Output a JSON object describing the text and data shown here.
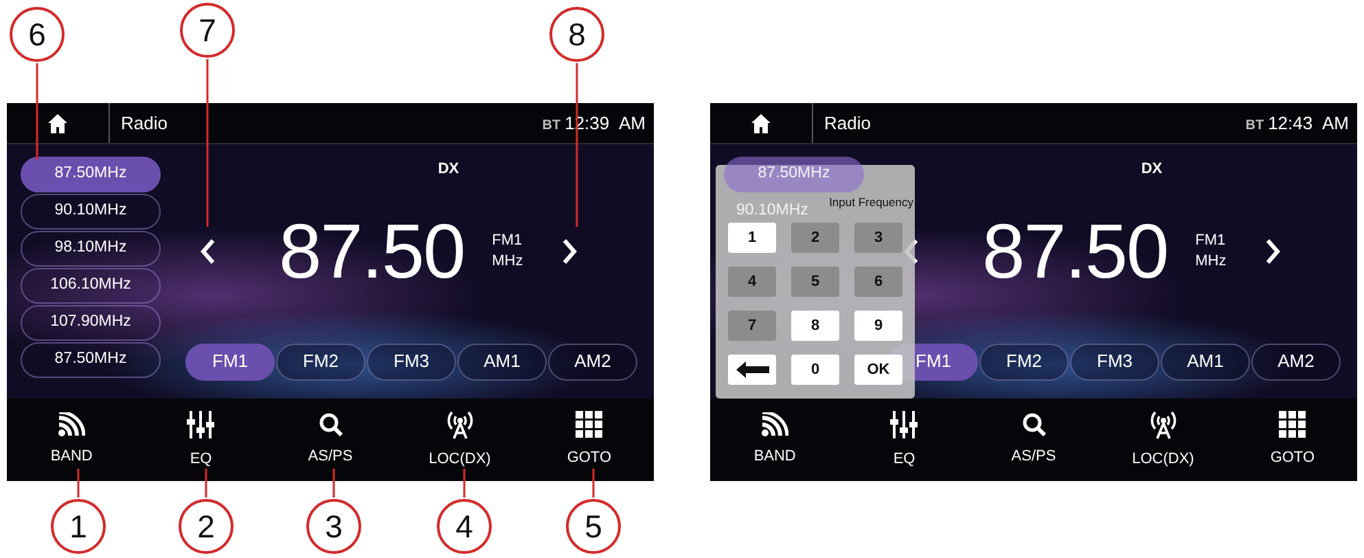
{
  "callouts": [
    {
      "number": "6"
    },
    {
      "number": "7"
    },
    {
      "number": "8"
    },
    {
      "number": "1"
    },
    {
      "number": "2"
    },
    {
      "number": "3"
    },
    {
      "number": "4"
    },
    {
      "number": "5"
    }
  ],
  "screens": [
    {
      "title": "Radio",
      "bt": "BT",
      "time": "12:39 AM",
      "presets": [
        {
          "label": "87.50MHz",
          "selected": true
        },
        {
          "label": "90.10MHz",
          "selected": false
        },
        {
          "label": "98.10MHz",
          "selected": false
        },
        {
          "label": "106.10MHz",
          "selected": false
        },
        {
          "label": "107.90MHz",
          "selected": false
        },
        {
          "label": "87.50MHz",
          "selected": false
        }
      ],
      "mode": "DX",
      "frequency": "87.50",
      "band": "FM1",
      "unit": "MHz",
      "bands": [
        {
          "label": "FM1",
          "selected": true
        },
        {
          "label": "FM2",
          "selected": false
        },
        {
          "label": "FM3",
          "selected": false
        },
        {
          "label": "AM1",
          "selected": false
        },
        {
          "label": "AM2",
          "selected": false
        }
      ],
      "buttons": [
        {
          "label": "BAND",
          "kind": "band"
        },
        {
          "label": "EQ",
          "kind": "eq"
        },
        {
          "label": "AS/PS",
          "kind": "search"
        },
        {
          "label": "LOC(DX)",
          "kind": "antenna"
        },
        {
          "label": "GOTO",
          "kind": "grid"
        }
      ]
    },
    {
      "title": "Radio",
      "bt": "BT",
      "time": "12:43 AM",
      "presets": [
        {
          "label": "87.50MHz",
          "selected": true
        },
        {
          "label": "90.10MHz",
          "selected": false
        }
      ],
      "mode": "DX",
      "frequency": "87.50",
      "band": "FM1",
      "unit": "MHz",
      "bands": [
        {
          "label": "FM1",
          "selected": true
        },
        {
          "label": "FM2",
          "selected": false
        },
        {
          "label": "FM3",
          "selected": false
        },
        {
          "label": "AM1",
          "selected": false
        },
        {
          "label": "AM2",
          "selected": false
        }
      ],
      "buttons": [
        {
          "label": "BAND",
          "kind": "band"
        },
        {
          "label": "EQ",
          "kind": "eq"
        },
        {
          "label": "AS/PS",
          "kind": "search"
        },
        {
          "label": "LOC(DX)",
          "kind": "antenna"
        },
        {
          "label": "GOTO",
          "kind": "grid"
        }
      ],
      "keypad": {
        "title": "Input Frequency",
        "keys": [
          {
            "kind": "digit",
            "label": "1",
            "enabled": true
          },
          {
            "kind": "digit",
            "label": "2",
            "enabled": false
          },
          {
            "kind": "digit",
            "label": "3",
            "enabled": false
          },
          {
            "kind": "digit",
            "label": "4",
            "enabled": false
          },
          {
            "kind": "digit",
            "label": "5",
            "enabled": false
          },
          {
            "kind": "digit",
            "label": "6",
            "enabled": false
          },
          {
            "kind": "digit",
            "label": "7",
            "enabled": false
          },
          {
            "kind": "digit",
            "label": "8",
            "enabled": true
          },
          {
            "kind": "digit",
            "label": "9",
            "enabled": true
          },
          {
            "kind": "back",
            "enabled": true
          },
          {
            "kind": "digit",
            "label": "0",
            "enabled": true
          },
          {
            "kind": "digit",
            "label": "OK",
            "enabled": true
          }
        ]
      }
    }
  ]
}
